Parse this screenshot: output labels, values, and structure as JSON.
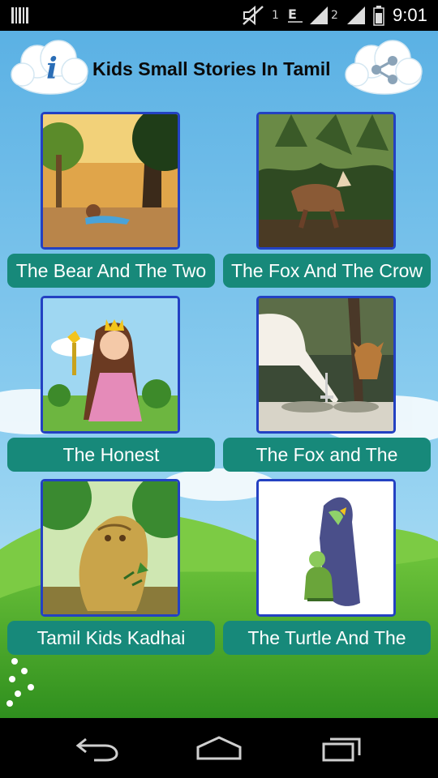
{
  "status_bar": {
    "sim1": "1",
    "sim2": "2",
    "time": "9:01",
    "icons": [
      "barcode-icon",
      "mute-icon",
      "data-icon",
      "signal-icon",
      "signal-icon",
      "battery-icon"
    ]
  },
  "header": {
    "title": "Kids Small Stories In Tamil",
    "info_icon_glyph": "i",
    "info_icon": "info-icon",
    "share_icon": "share-icon"
  },
  "stories": [
    {
      "label": "The Bear And The Two",
      "image": "bear-story-thumbnail"
    },
    {
      "label": "The Fox And The Crow",
      "image": "fox-crow-thumbnail"
    },
    {
      "label": "The Honest",
      "image": "honest-woodcutter-thumbnail"
    },
    {
      "label": "The Fox and The",
      "image": "fox-stork-thumbnail"
    },
    {
      "label": "Tamil Kids Kadhai",
      "image": "tree-character-thumbnail"
    },
    {
      "label": "The Turtle And The",
      "image": "turtle-bird-thumbnail"
    }
  ],
  "nav_bar": {
    "buttons": [
      "back-icon",
      "home-icon",
      "recent-apps-icon"
    ]
  },
  "colors": {
    "card_label_bg": "#17897a",
    "thumb_border": "#2341c2",
    "sky": "#7ec4ea",
    "grass": "#4fae2c"
  }
}
